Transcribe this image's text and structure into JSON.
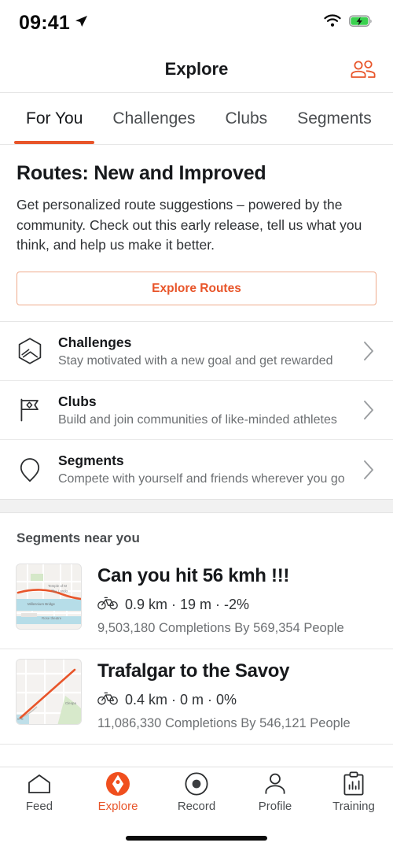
{
  "status_bar": {
    "time": "09:41",
    "location_icon": "location-arrow-icon",
    "wifi_icon": "wifi-icon",
    "battery_icon": "battery-charging-icon"
  },
  "header": {
    "title": "Explore",
    "action_icon": "people-group-icon",
    "accent_color": "#e8552a"
  },
  "tabs": [
    {
      "label": "For You",
      "active": true
    },
    {
      "label": "Challenges",
      "active": false
    },
    {
      "label": "Clubs",
      "active": false
    },
    {
      "label": "Segments",
      "active": false
    }
  ],
  "promo": {
    "title": "Routes: New and Improved",
    "description": "Get personalized route suggestions – powered by the community. Check out this early release, tell us what you think, and help us make it better.",
    "button_label": "Explore Routes"
  },
  "nav_rows": [
    {
      "icon": "hexagon-challenge-icon",
      "title": "Challenges",
      "subtitle": "Stay motivated with a new goal and get rewarded",
      "chevron": "chevron-right-icon"
    },
    {
      "icon": "flag-club-icon",
      "title": "Clubs",
      "subtitle": "Build and join communities of like-minded athletes",
      "chevron": "chevron-right-icon"
    },
    {
      "icon": "pin-segment-icon",
      "title": "Segments",
      "subtitle": "Compete with yourself and friends wherever you go",
      "chevron": "chevron-right-icon"
    }
  ],
  "segments_section": {
    "heading": "Segments near you",
    "items": [
      {
        "title": "Can you hit 56 kmh !!!",
        "activity_icon": "bicycle-icon",
        "stats": "0.9 km · 19 m · -2%",
        "distance": "0.9 km",
        "elevation": "19 m",
        "grade": "-2%",
        "completions": "9,503,180 Completions By 569,354 People",
        "map_labels": [
          "Temple of M",
          "The Londo",
          "Millennium Bridge",
          "Rose theatre"
        ],
        "route_color": "#e8552a"
      },
      {
        "title": "Trafalgar to the Savoy",
        "activity_icon": "bicycle-icon",
        "stats": "0.4 km · 0 m · 0%",
        "distance": "0.4 km",
        "elevation": "0 m",
        "grade": "0%",
        "completions": "11,086,330 Completions By 546,121 People",
        "map_labels": [
          "Cleopa"
        ],
        "route_color": "#e8552a"
      }
    ]
  },
  "bottom_nav": [
    {
      "label": "Feed",
      "icon": "home-icon",
      "active": false
    },
    {
      "label": "Explore",
      "icon": "explore-compass-icon",
      "active": true
    },
    {
      "label": "Record",
      "icon": "record-dot-icon",
      "active": false
    },
    {
      "label": "Profile",
      "icon": "person-icon",
      "active": false
    },
    {
      "label": "Training",
      "icon": "clipboard-chart-icon",
      "active": false
    }
  ]
}
